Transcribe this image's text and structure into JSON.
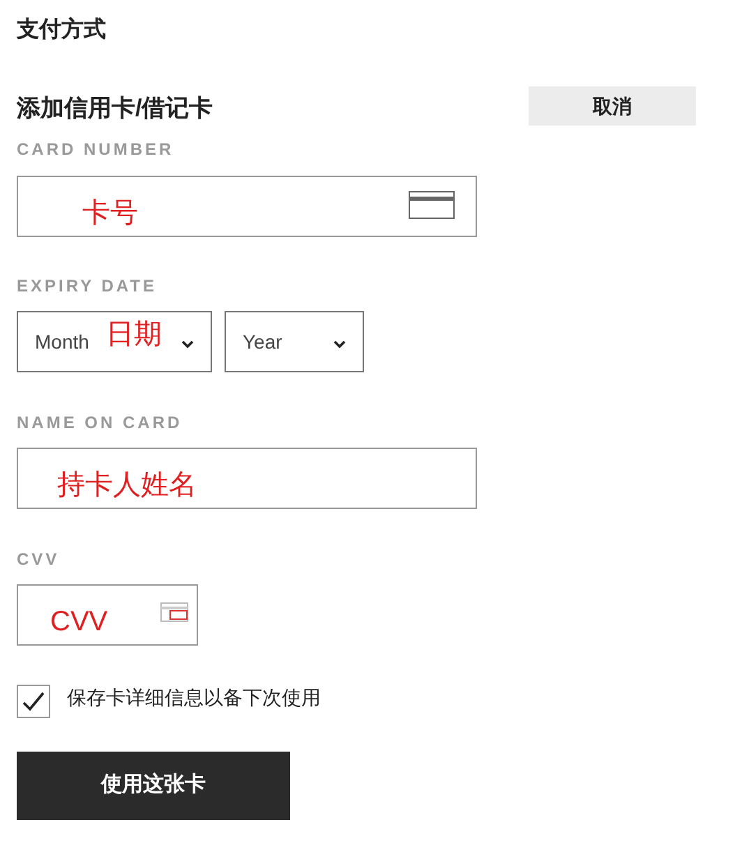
{
  "page_title": "支付方式",
  "form": {
    "title": "添加信用卡/借记卡",
    "cancel_button": "取消",
    "card_number": {
      "label": "CARD NUMBER",
      "annotation": "卡号"
    },
    "expiry": {
      "label": "EXPIRY DATE",
      "month": {
        "placeholder": "Month",
        "annotation": "日期"
      },
      "year": {
        "placeholder": "Year"
      }
    },
    "name_on_card": {
      "label": "NAME ON CARD",
      "annotation": "持卡人姓名"
    },
    "cvv": {
      "label": "CVV",
      "annotation": "CVV"
    },
    "save_card": {
      "label": "保存卡详细信息以备下次使用",
      "checked": true
    },
    "submit_button": "使用这张卡"
  }
}
